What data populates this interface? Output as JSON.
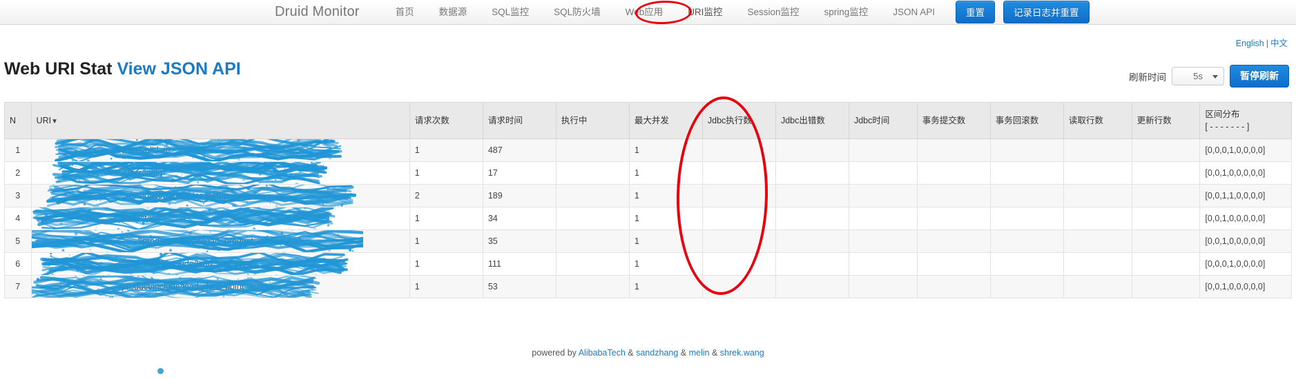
{
  "navbar": {
    "brand": "Druid Monitor",
    "links": [
      {
        "label": "首页",
        "active": false
      },
      {
        "label": "数据源",
        "active": false
      },
      {
        "label": "SQL监控",
        "active": false
      },
      {
        "label": "SQL防火墙",
        "active": false
      },
      {
        "label": "Web应用",
        "active": false
      },
      {
        "label": "URI监控",
        "active": true
      },
      {
        "label": "Session监控",
        "active": false
      },
      {
        "label": "spring监控",
        "active": false
      },
      {
        "label": "JSON API",
        "active": false
      }
    ],
    "reset_button": "重置",
    "log_and_reset_button": "记录日志并重置"
  },
  "language": {
    "english": "English",
    "separator": "|",
    "chinese": "中文"
  },
  "page": {
    "title": "Web URI Stat",
    "api_link": "View JSON API"
  },
  "refresh": {
    "label": "刷新时间",
    "interval_value": "5s",
    "pause_button": "暂停刷新"
  },
  "table": {
    "headers": {
      "n": "N",
      "uri": "URI",
      "uri_sort_caret": "▼",
      "request_count": "请求次数",
      "request_time": "请求时间",
      "running": "执行中",
      "max_concurrent": "最大并发",
      "jdbc_exec": "Jdbc执行数",
      "jdbc_error": "Jdbc出错数",
      "jdbc_time": "Jdbc时间",
      "tx_commit": "事务提交数",
      "tx_rollback": "事务回滚数",
      "read_rows": "读取行数",
      "update_rows": "更新行数",
      "dist_line1": "区间分布",
      "dist_line2": "[ - - - - - - - ]"
    },
    "rows": [
      {
        "n": "1",
        "uri_visible": "/user/validate",
        "request_count": "1",
        "request_time": "487",
        "running": "",
        "max_concurrent": "1",
        "jdbc_exec": "",
        "jdbc_error": "",
        "jdbc_time": "",
        "tx_commit": "",
        "tx_rollback": "",
        "read_rows": "",
        "update_rows": "",
        "distribution": "[0,0,0,1,0,0,0,0]"
      },
      {
        "n": "2",
        "uri_visible": "/user/login",
        "request_count": "1",
        "request_time": "17",
        "running": "",
        "max_concurrent": "1",
        "jdbc_exec": "",
        "jdbc_error": "",
        "jdbc_time": "",
        "tx_commit": "",
        "tx_rollback": "",
        "read_rows": "",
        "update_rows": "",
        "distribution": "[0,0,1,0,0,0,0,0]"
      },
      {
        "n": "3",
        "uri_visible": "/product/parameter_setup",
        "request_count": "2",
        "request_time": "189",
        "running": "",
        "max_concurrent": "1",
        "jdbc_exec": "",
        "jdbc_error": "",
        "jdbc_time": "",
        "tx_commit": "",
        "tx_rollback": "",
        "read_rows": "",
        "update_rows": "",
        "distribution": "[0,0,1,1,0,0,0,0]"
      },
      {
        "n": "4",
        "uri_visible": "/product/list",
        "request_count": "1",
        "request_time": "34",
        "running": "",
        "max_concurrent": "1",
        "jdbc_exec": "",
        "jdbc_error": "",
        "jdbc_time": "",
        "tx_commit": "",
        "tx_rollback": "",
        "read_rows": "",
        "update_rows": "",
        "distribution": "[0,0,1,0,0,0,0,0]"
      },
      {
        "n": "5",
        "uri_visible": "/product/include/load_product_info",
        "request_count": "1",
        "request_time": "35",
        "running": "",
        "max_concurrent": "1",
        "jdbc_exec": "",
        "jdbc_error": "",
        "jdbc_time": "",
        "tx_commit": "",
        "tx_rollback": "",
        "read_rows": "",
        "update_rows": "",
        "distribution": "[0,0,1,0,0,0,0,0]"
      },
      {
        "n": "6",
        "uri_visible": "/product/include/load_pro_list",
        "request_count": "1",
        "request_time": "111",
        "running": "",
        "max_concurrent": "1",
        "jdbc_exec": "",
        "jdbc_error": "",
        "jdbc_time": "",
        "tx_commit": "",
        "tx_rollback": "",
        "read_rows": "",
        "update_rows": "",
        "distribution": "[0,0,0,1,0,0,0,0]"
      },
      {
        "n": "7",
        "uri_visible": "/product/include/load_data_point_action",
        "request_count": "1",
        "request_time": "53",
        "running": "",
        "max_concurrent": "1",
        "jdbc_exec": "",
        "jdbc_error": "",
        "jdbc_time": "",
        "tx_commit": "",
        "tx_rollback": "",
        "read_rows": "",
        "update_rows": "",
        "distribution": "[0,0,1,0,0,0,0,0]"
      }
    ]
  },
  "footer": {
    "powered_by": "powered by",
    "amp": "&",
    "credits": [
      "AlibabaTech",
      "sandzhang",
      "melin",
      "shrek.wang"
    ]
  },
  "colors": {
    "accent_blue": "#1a7bc4",
    "button_blue": "#0e6ec9",
    "annotation_red": "#e8000d",
    "redaction_blue": "#2196d6",
    "header_gray": "#e9e9e9"
  }
}
